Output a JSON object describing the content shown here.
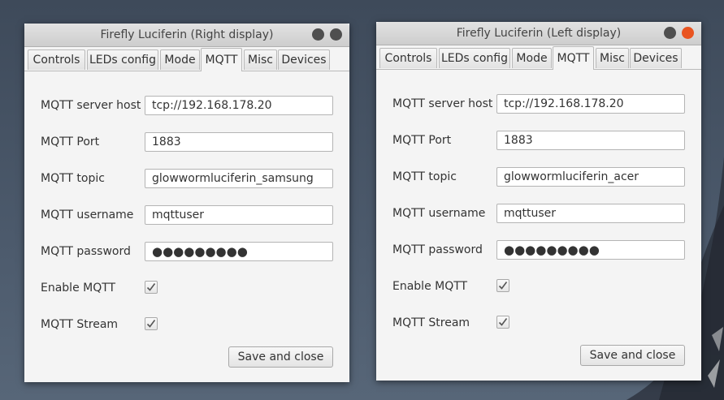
{
  "windows": {
    "right": {
      "title": "Firefly Luciferin (Right display)",
      "tabs": [
        "Controls",
        "LEDs config",
        "Mode",
        "MQTT",
        "Misc",
        "Devices"
      ],
      "selected_tab": "MQTT",
      "labels": {
        "server_host": "MQTT server host",
        "port": "MQTT Port",
        "topic": "MQTT topic",
        "username": "MQTT username",
        "password": "MQTT password",
        "enable": "Enable MQTT",
        "stream": "MQTT Stream"
      },
      "values": {
        "server_host": "tcp://192.168.178.20",
        "port": "1883",
        "topic": "glowwormluciferin_samsung",
        "username": "mqttuser",
        "password": "●●●●●●●●●"
      },
      "enable_checked": true,
      "stream_checked": true,
      "save_label": "Save and close"
    },
    "left": {
      "title": "Firefly Luciferin (Left display)",
      "tabs": [
        "Controls",
        "LEDs config",
        "Mode",
        "MQTT",
        "Misc",
        "Devices"
      ],
      "selected_tab": "MQTT",
      "labels": {
        "server_host": "MQTT server host",
        "port": "MQTT Port",
        "topic": "MQTT topic",
        "username": "MQTT username",
        "password": "MQTT password",
        "enable": "Enable MQTT",
        "stream": "MQTT Stream"
      },
      "values": {
        "server_host": "tcp://192.168.178.20",
        "port": "1883",
        "topic": "glowwormluciferin_acer",
        "username": "mqttuser",
        "password": "●●●●●●●●●"
      },
      "enable_checked": true,
      "stream_checked": true,
      "save_label": "Save and close"
    }
  },
  "colors": {
    "close_button_active": "#e95420",
    "window_bg": "#f4f4f4",
    "desktop_bg": "#4c5a6c"
  }
}
